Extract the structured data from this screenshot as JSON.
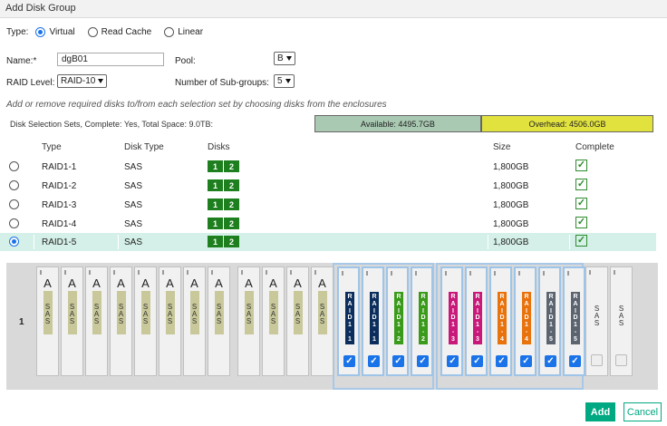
{
  "window": {
    "title": "Add Disk Group"
  },
  "type_field": {
    "label": "Type:",
    "options": [
      {
        "label": "Virtual",
        "selected": true
      },
      {
        "label": "Read Cache",
        "selected": false
      },
      {
        "label": "Linear",
        "selected": false
      }
    ]
  },
  "name_field": {
    "label": "Name:*",
    "value": "dgB01"
  },
  "pool_field": {
    "label": "Pool:",
    "value": "B"
  },
  "raid_field": {
    "label": "RAID Level:",
    "value": "RAID-10"
  },
  "subgroups_field": {
    "label": "Number of Sub-groups:",
    "value": "5"
  },
  "hint": "Add or remove required disks to/from each selection set by choosing disks from the enclosures",
  "summary": {
    "text": "Disk Selection Sets, Complete: Yes, Total Space: 9.0TB:",
    "available": "Available: 4495.7GB",
    "overhead": "Overhead: 4506.0GB"
  },
  "table": {
    "headers": {
      "type": "Type",
      "disk_type": "Disk Type",
      "disks": "Disks",
      "size": "Size",
      "complete": "Complete"
    },
    "rows": [
      {
        "type": "RAID1-1",
        "disk_type": "SAS",
        "disks": [
          "1",
          "2"
        ],
        "size": "1,800GB",
        "complete": true,
        "selected": false
      },
      {
        "type": "RAID1-2",
        "disk_type": "SAS",
        "disks": [
          "1",
          "2"
        ],
        "size": "1,800GB",
        "complete": true,
        "selected": false
      },
      {
        "type": "RAID1-3",
        "disk_type": "SAS",
        "disks": [
          "1",
          "2"
        ],
        "size": "1,800GB",
        "complete": true,
        "selected": false
      },
      {
        "type": "RAID1-4",
        "disk_type": "SAS",
        "disks": [
          "1",
          "2"
        ],
        "size": "1,800GB",
        "complete": true,
        "selected": false
      },
      {
        "type": "RAID1-5",
        "disk_type": "SAS",
        "disks": [
          "1",
          "2"
        ],
        "size": "1,800GB",
        "complete": true,
        "selected": true
      }
    ]
  },
  "enclosure": {
    "label": "1",
    "slots": [
      {
        "kind": "avail",
        "letter": "A",
        "text": "SAS"
      },
      {
        "kind": "avail",
        "letter": "A",
        "text": "SAS"
      },
      {
        "kind": "avail",
        "letter": "A",
        "text": "SAS"
      },
      {
        "kind": "avail",
        "letter": "A",
        "text": "SAS"
      },
      {
        "kind": "avail",
        "letter": "A",
        "text": "SAS"
      },
      {
        "kind": "avail",
        "letter": "A",
        "text": "SAS"
      },
      {
        "kind": "avail",
        "letter": "A",
        "text": "SAS"
      },
      {
        "kind": "avail",
        "letter": "A",
        "text": "SAS"
      },
      {
        "kind": "avail",
        "letter": "A",
        "text": "SAS"
      },
      {
        "kind": "avail",
        "letter": "A",
        "text": "SAS"
      },
      {
        "kind": "avail",
        "letter": "A",
        "text": "SAS"
      },
      {
        "kind": "avail",
        "letter": "A",
        "text": "SAS"
      },
      {
        "kind": "member",
        "text": "RAID1-1",
        "color": "#0b2e5c",
        "checked": true
      },
      {
        "kind": "member",
        "text": "RAID1-1",
        "color": "#0b2e5c",
        "checked": true
      },
      {
        "kind": "member",
        "text": "RAID1-2",
        "color": "#3a9a1a",
        "checked": true
      },
      {
        "kind": "member",
        "text": "RAID1-2",
        "color": "#3a9a1a",
        "checked": true
      },
      {
        "kind": "member",
        "text": "RAID1-3",
        "color": "#c8187a",
        "checked": true
      },
      {
        "kind": "member",
        "text": "RAID1-3",
        "color": "#c8187a",
        "checked": true
      },
      {
        "kind": "member",
        "text": "RAID1-4",
        "color": "#e8720c",
        "checked": true
      },
      {
        "kind": "member",
        "text": "RAID1-4",
        "color": "#e8720c",
        "checked": true
      },
      {
        "kind": "member",
        "text": "RAID1-5",
        "color": "#5c6470",
        "checked": true
      },
      {
        "kind": "member",
        "text": "RAID1-5",
        "color": "#5c6470",
        "checked": true
      },
      {
        "kind": "free",
        "text": "SAS",
        "checked": false
      },
      {
        "kind": "free",
        "text": "SAS",
        "checked": false
      }
    ]
  },
  "buttons": {
    "add": "Add",
    "cancel": "Cancel"
  },
  "colors": {
    "accent": "#01a982",
    "available": "#a9c9b2",
    "overhead": "#e2e23f",
    "disk_badge": "#1e7f1e"
  }
}
